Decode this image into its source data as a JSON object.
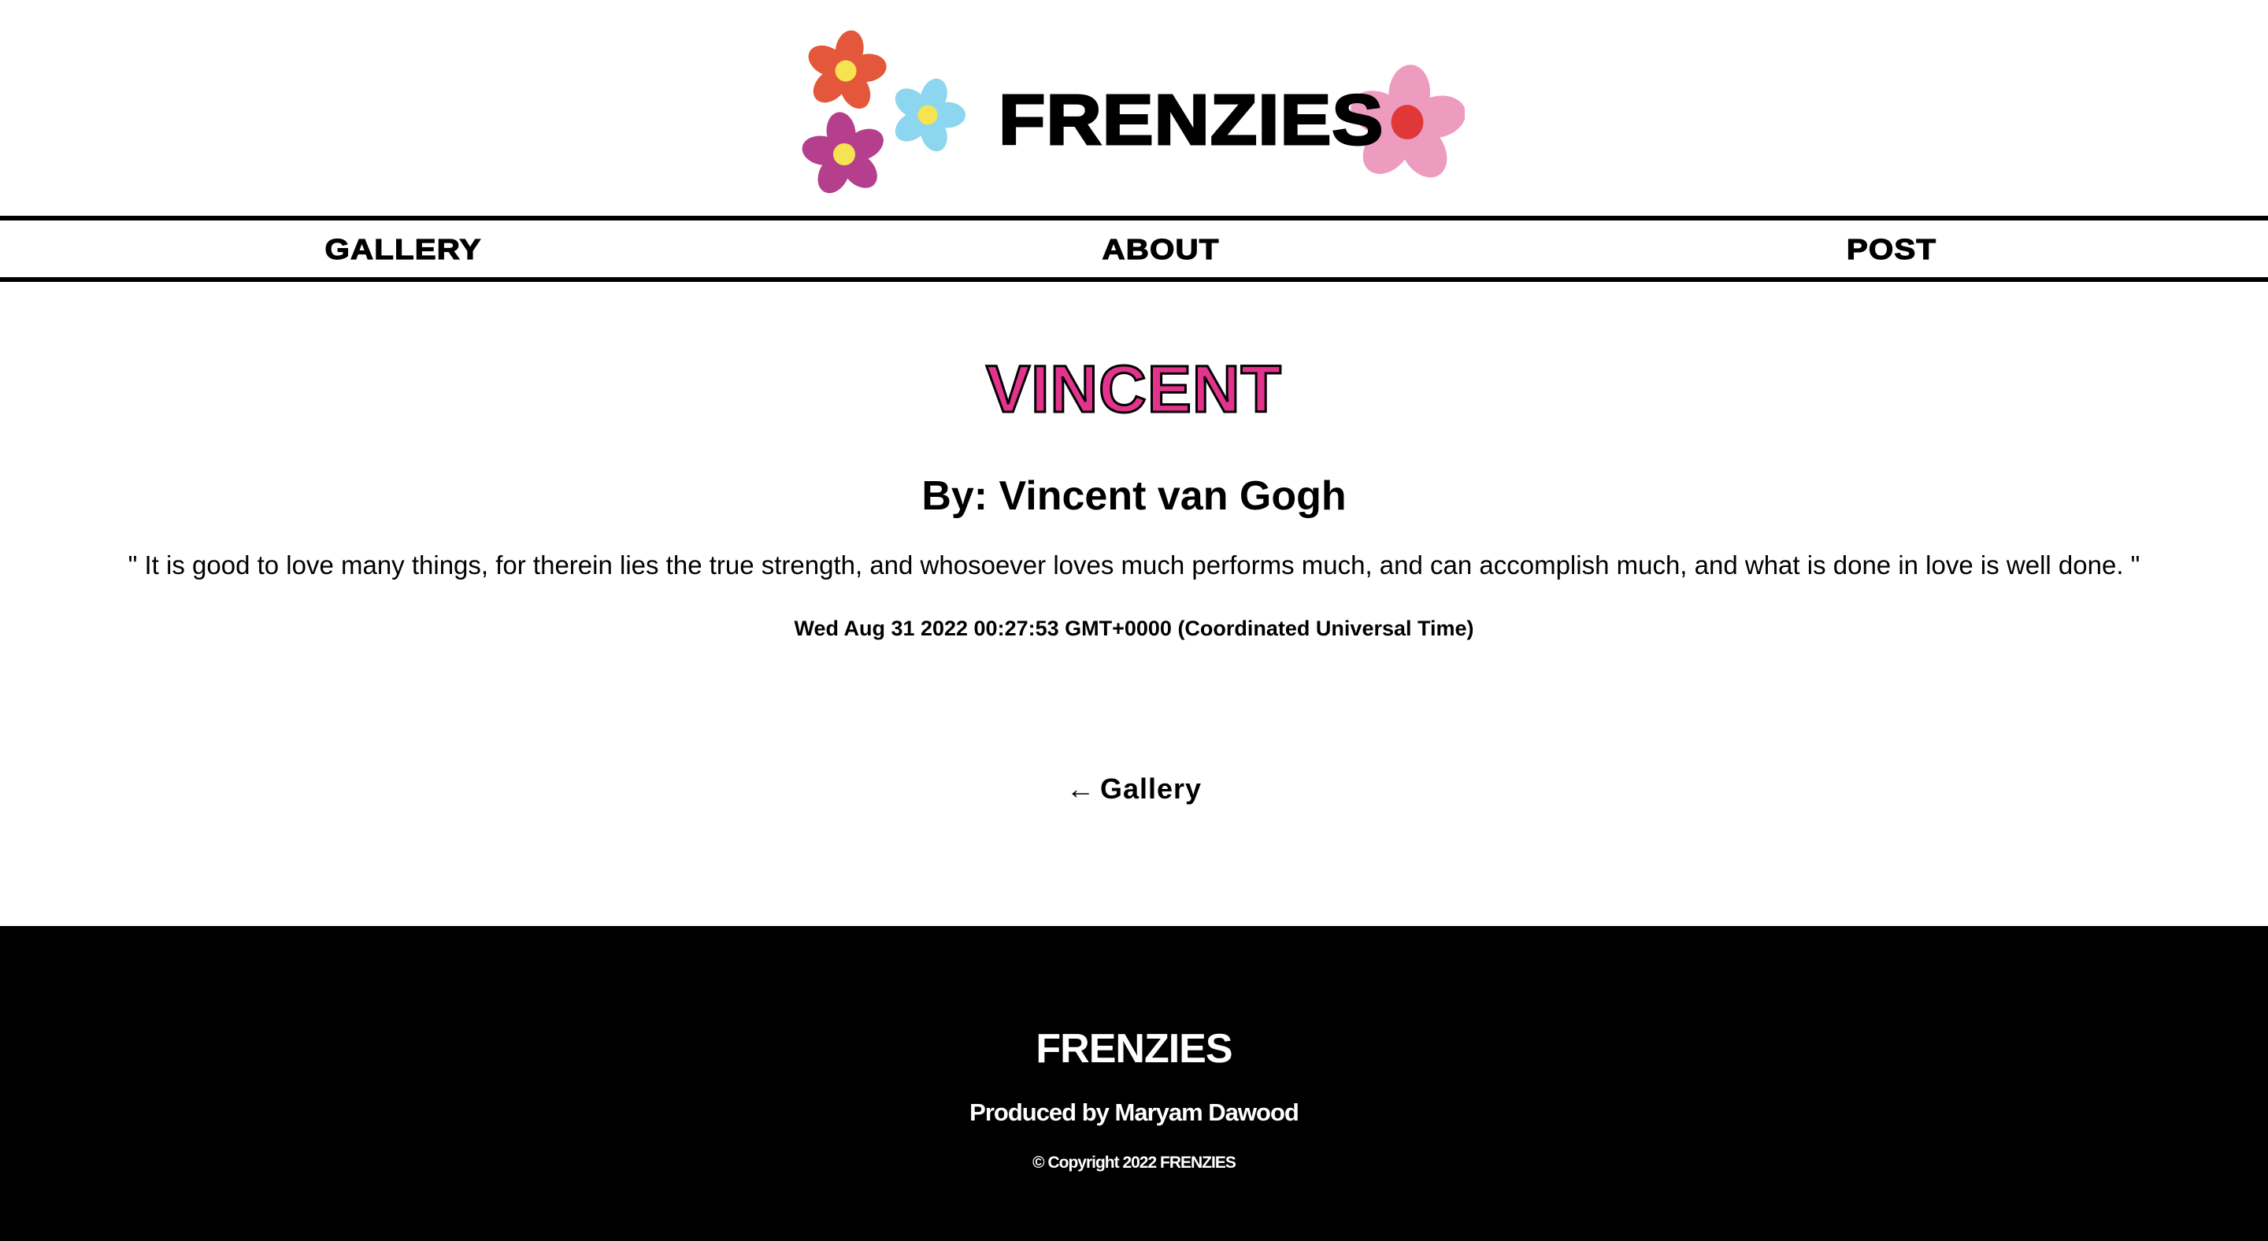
{
  "header": {
    "brand": "FRENZIES",
    "flowers": [
      {
        "name": "orange-flower-icon",
        "petal": "#e4573a",
        "center": "#f5e352"
      },
      {
        "name": "purple-flower-icon",
        "petal": "#b53f8d",
        "center": "#f5e352"
      },
      {
        "name": "blue-flower-icon",
        "petal": "#8dd6ef",
        "center": "#f5e352"
      },
      {
        "name": "pink-flower-icon",
        "petal": "#ed9cc0",
        "center": "#e03838"
      }
    ]
  },
  "nav": {
    "gallery": "GALLERY",
    "about": "ABOUT",
    "post": "POST"
  },
  "post": {
    "title": "VINCENT",
    "author": "By: Vincent van Gogh",
    "quote": "\" It is good to love many things, for therein lies the true strength, and whosoever loves much performs much, and can accomplish much, and what is done in love is well done. \"",
    "date": "Wed Aug 31 2022 00:27:53 GMT+0000 (Coordinated Universal Time)"
  },
  "back_link": {
    "arrow": "←",
    "label": "Gallery"
  },
  "footer": {
    "brand": "FRENZIES",
    "credit": "Produced by Maryam Dawood",
    "copyright": "© Copyright 2022 FRENZIES"
  },
  "colors": {
    "title_pink": "#e2348d",
    "footer_bg": "#000000"
  }
}
